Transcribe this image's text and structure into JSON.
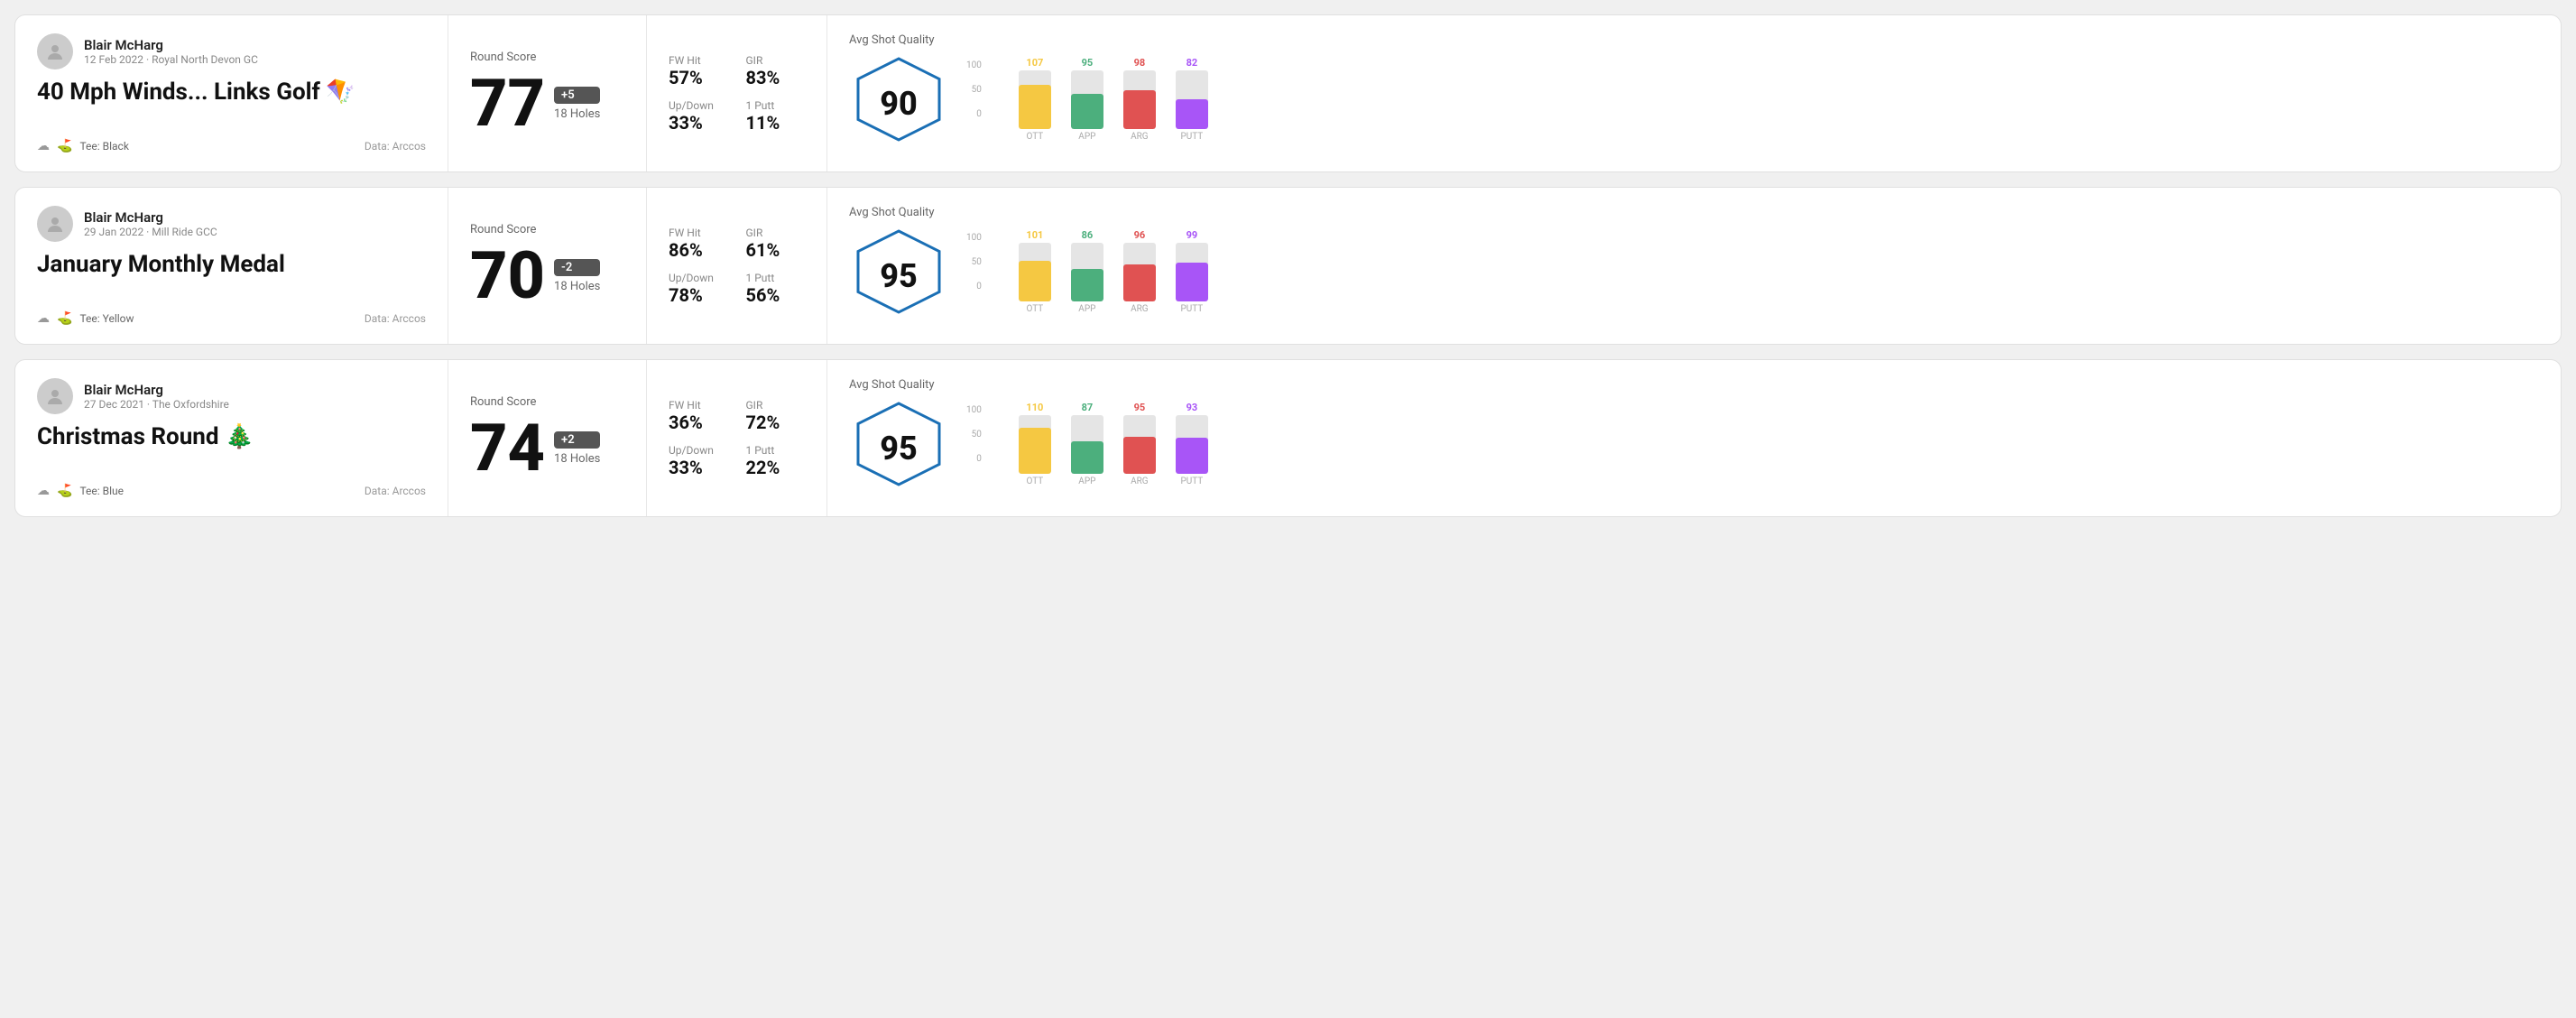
{
  "rounds": [
    {
      "id": "round-1",
      "user": {
        "name": "Blair McHarg",
        "date_course": "12 Feb 2022 · Royal North Devon GC"
      },
      "title": "40 Mph Winds... Links Golf 🪁",
      "tee": "Black",
      "data_source": "Data: Arccos",
      "score": {
        "label": "Round Score",
        "value": "77",
        "badge": "+5",
        "badge_type": "over",
        "holes": "18 Holes"
      },
      "stats": {
        "fw_hit_label": "FW Hit",
        "fw_hit_value": "57%",
        "gir_label": "GIR",
        "gir_value": "83%",
        "updown_label": "Up/Down",
        "updown_value": "33%",
        "oneputt_label": "1 Putt",
        "oneputt_value": "11%"
      },
      "quality": {
        "label": "Avg Shot Quality",
        "score": "90"
      },
      "chart": {
        "y_labels": [
          "100",
          "50",
          "0"
        ],
        "columns": [
          {
            "label": "OTT",
            "top_value": "107",
            "top_color": "#f5c842",
            "fill_height_pct": 75
          },
          {
            "label": "APP",
            "top_value": "95",
            "top_color": "#4caf7d",
            "fill_height_pct": 60
          },
          {
            "label": "ARG",
            "top_value": "98",
            "top_color": "#e05252",
            "fill_height_pct": 65
          },
          {
            "label": "PUTT",
            "top_value": "82",
            "top_color": "#a855f7",
            "fill_height_pct": 50
          }
        ]
      }
    },
    {
      "id": "round-2",
      "user": {
        "name": "Blair McHarg",
        "date_course": "29 Jan 2022 · Mill Ride GCC"
      },
      "title": "January Monthly Medal",
      "tee": "Yellow",
      "data_source": "Data: Arccos",
      "score": {
        "label": "Round Score",
        "value": "70",
        "badge": "-2",
        "badge_type": "under",
        "holes": "18 Holes"
      },
      "stats": {
        "fw_hit_label": "FW Hit",
        "fw_hit_value": "86%",
        "gir_label": "GIR",
        "gir_value": "61%",
        "updown_label": "Up/Down",
        "updown_value": "78%",
        "oneputt_label": "1 Putt",
        "oneputt_value": "56%"
      },
      "quality": {
        "label": "Avg Shot Quality",
        "score": "95"
      },
      "chart": {
        "y_labels": [
          "100",
          "50",
          "0"
        ],
        "columns": [
          {
            "label": "OTT",
            "top_value": "101",
            "top_color": "#f5c842",
            "fill_height_pct": 68
          },
          {
            "label": "APP",
            "top_value": "86",
            "top_color": "#4caf7d",
            "fill_height_pct": 54
          },
          {
            "label": "ARG",
            "top_value": "96",
            "top_color": "#e05252",
            "fill_height_pct": 63
          },
          {
            "label": "PUTT",
            "top_value": "99",
            "top_color": "#a855f7",
            "fill_height_pct": 66
          }
        ]
      }
    },
    {
      "id": "round-3",
      "user": {
        "name": "Blair McHarg",
        "date_course": "27 Dec 2021 · The Oxfordshire"
      },
      "title": "Christmas Round 🎄",
      "tee": "Blue",
      "data_source": "Data: Arccos",
      "score": {
        "label": "Round Score",
        "value": "74",
        "badge": "+2",
        "badge_type": "over",
        "holes": "18 Holes"
      },
      "stats": {
        "fw_hit_label": "FW Hit",
        "fw_hit_value": "36%",
        "gir_label": "GIR",
        "gir_value": "72%",
        "updown_label": "Up/Down",
        "updown_value": "33%",
        "oneputt_label": "1 Putt",
        "oneputt_value": "22%"
      },
      "quality": {
        "label": "Avg Shot Quality",
        "score": "95"
      },
      "chart": {
        "y_labels": [
          "100",
          "50",
          "0"
        ],
        "columns": [
          {
            "label": "OTT",
            "top_value": "110",
            "top_color": "#f5c842",
            "fill_height_pct": 78
          },
          {
            "label": "APP",
            "top_value": "87",
            "top_color": "#4caf7d",
            "fill_height_pct": 55
          },
          {
            "label": "ARG",
            "top_value": "95",
            "top_color": "#e05252",
            "fill_height_pct": 62
          },
          {
            "label": "PUTT",
            "top_value": "93",
            "top_color": "#a855f7",
            "fill_height_pct": 61
          }
        ]
      }
    }
  ],
  "labels": {
    "round_score": "Round Score",
    "avg_shot_quality": "Avg Shot Quality",
    "data_prefix": "Data: Arccos",
    "tee_prefix": "Tee:"
  }
}
